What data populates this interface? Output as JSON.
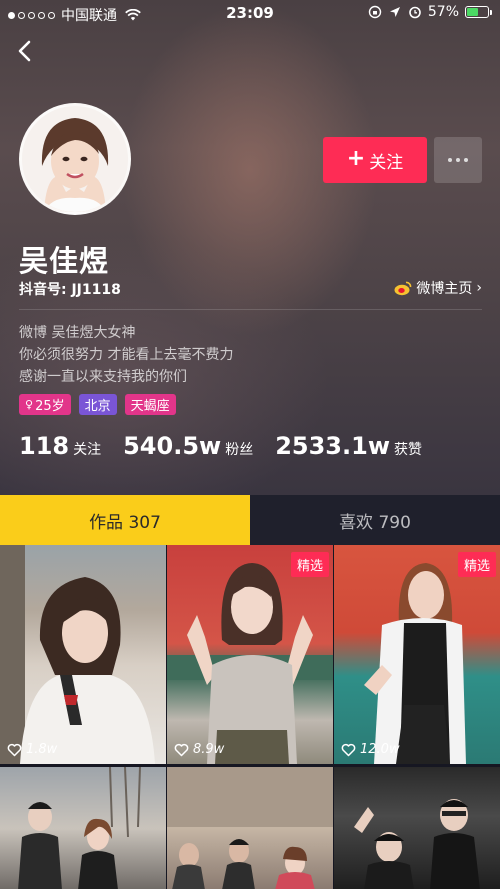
{
  "status_bar": {
    "carrier": "中国联通",
    "time": "23:09",
    "battery_percent": "57%"
  },
  "profile": {
    "name": "吴佳煜",
    "douyin_id": "抖音号: JJ1118",
    "weibo_link": "微博主页",
    "bio_lines": [
      "微博  吴佳煜大女神",
      "你必须很努力 才能看上去毫不费力",
      "感谢一直以来支持我的你们"
    ],
    "tags": {
      "age": "25岁",
      "city": "北京",
      "zodiac": "天蝎座"
    },
    "follow_button": "关注"
  },
  "stats": {
    "following": {
      "value": "118",
      "label": "关注"
    },
    "fans": {
      "value": "540.5w",
      "label": "粉丝"
    },
    "likes": {
      "value": "2533.1w",
      "label": "获赞"
    }
  },
  "tabs": [
    {
      "label": "作品 307",
      "active": true
    },
    {
      "label": "喜欢 790",
      "active": false
    }
  ],
  "videos": [
    {
      "likes": "1.8w",
      "featured": false
    },
    {
      "likes": "8.9w",
      "featured": true,
      "badge": "精选"
    },
    {
      "likes": "12.0w",
      "featured": true,
      "badge": "精选"
    }
  ],
  "colors": {
    "accent_red": "#fe2c55",
    "tab_yellow": "#facd1a",
    "battery_green": "#4cd964"
  }
}
